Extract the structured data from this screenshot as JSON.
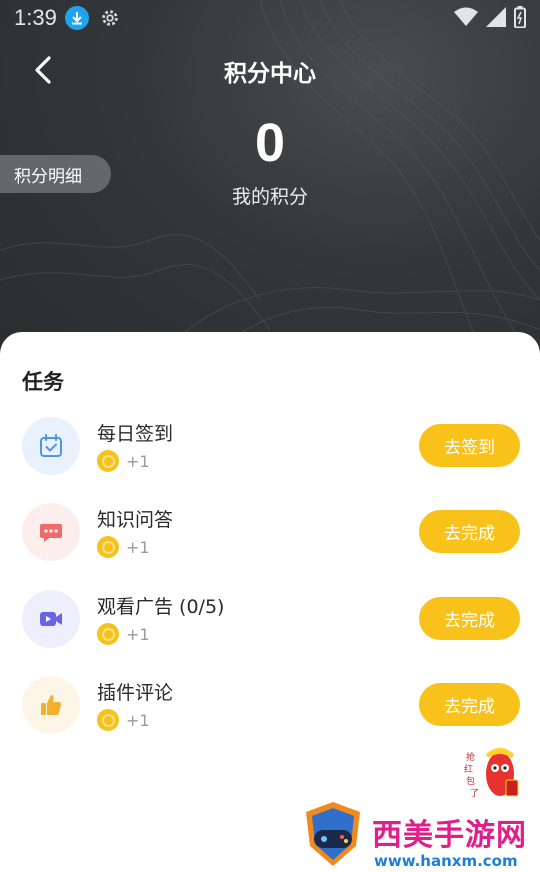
{
  "status_bar": {
    "time": "1:39"
  },
  "nav": {
    "title": "积分中心"
  },
  "points": {
    "value": "0",
    "label": "我的积分"
  },
  "detail_button": "积分明细",
  "tasks_section": {
    "title": "任务",
    "tasks": [
      {
        "name": "每日签到",
        "reward": "+1",
        "button": "去签到",
        "icon": "calendar-check-icon",
        "icon_bg": "#e9f2fc",
        "icon_color": "#4f95e8"
      },
      {
        "name": "知识问答",
        "reward": "+1",
        "button": "去完成",
        "icon": "chat-bubble-icon",
        "icon_bg": "#fdeeee",
        "icon_color": "#f06a6a"
      },
      {
        "name": "观看广告 (0/5)",
        "reward": "+1",
        "button": "去完成",
        "icon": "video-camera-icon",
        "icon_bg": "#eeeefc",
        "icon_color": "#6b63e6"
      },
      {
        "name": "插件评论",
        "reward": "+1",
        "button": "去完成",
        "icon": "thumbs-up-icon",
        "icon_bg": "#fdf6e6",
        "icon_color": "#f3b12b"
      }
    ]
  },
  "watermark": {
    "title": "西美手游网",
    "url": "www.hanxm.com",
    "badge": "抢红包了"
  },
  "colors": {
    "accent": "#f8c21a",
    "header_bg": "#34373a"
  }
}
